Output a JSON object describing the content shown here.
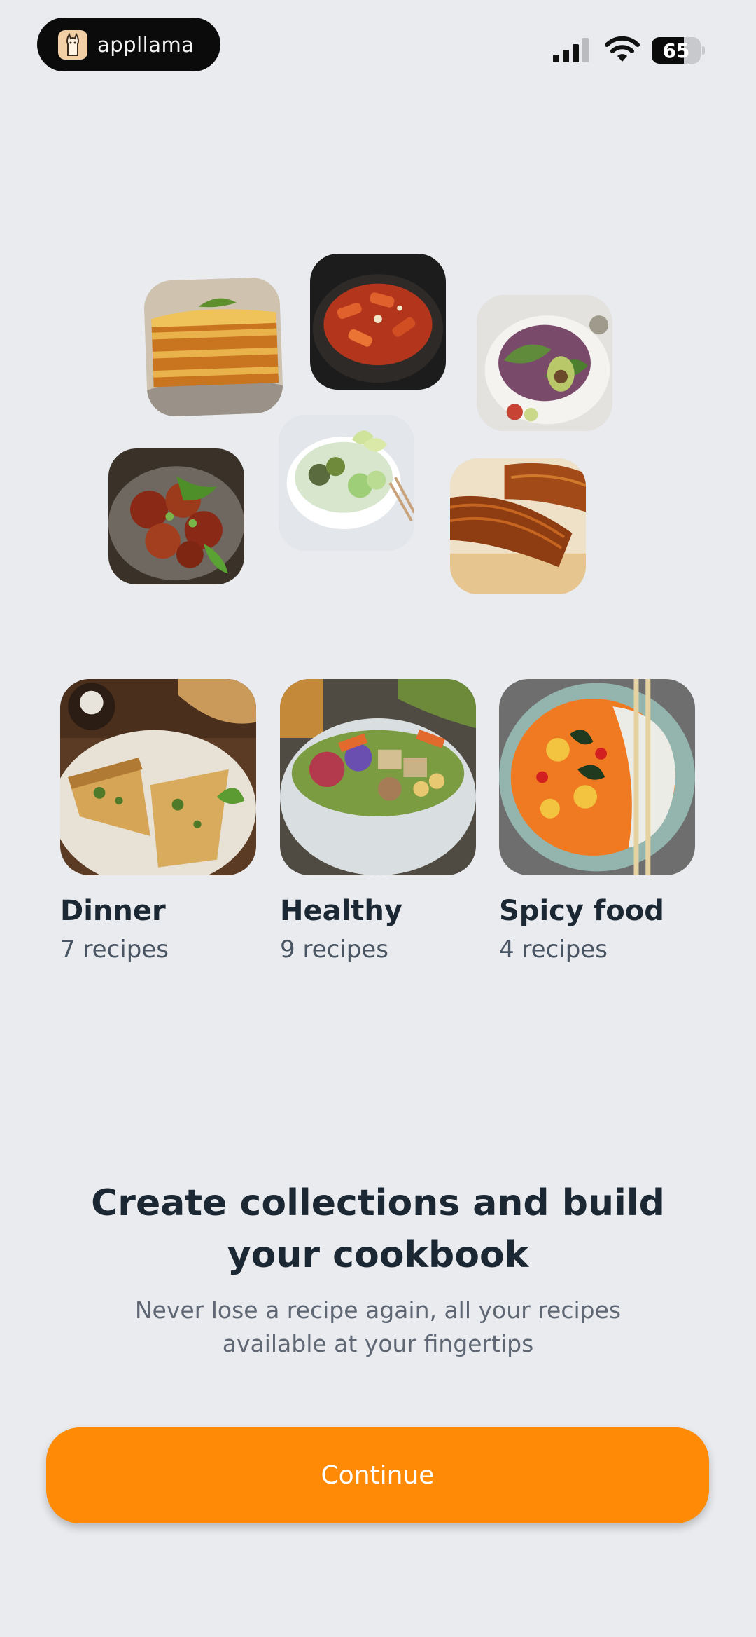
{
  "status_bar": {
    "brand_name": "appllama",
    "battery_level": "65",
    "battery_percent": 65,
    "icons": [
      "llama-logo-icon",
      "cellular-signal-icon",
      "wifi-icon",
      "battery-icon"
    ]
  },
  "collage": {
    "tiles": [
      "lasagna-photo",
      "rigatoni-pasta-photo",
      "avocado-salad-photo",
      "spicy-wings-photo",
      "edamame-bowl-photo",
      "glazed-eel-photo"
    ]
  },
  "categories": [
    {
      "title": "Dinner",
      "count": "7 recipes",
      "photo": "quiche-photo"
    },
    {
      "title": "Healthy",
      "count": "9 recipes",
      "photo": "tofu-buddha-bowl-photo"
    },
    {
      "title": "Spicy food",
      "count": "4 recipes",
      "photo": "red-curry-photo"
    }
  ],
  "onboarding": {
    "headline_line1": "Create collections and build",
    "headline_line2": "your cookbook",
    "subline_line1": "Never lose a recipe again, all your recipes",
    "subline_line2": "available at your fingertips"
  },
  "actions": {
    "continue_label": "Continue"
  },
  "colors": {
    "background": "#e9ebee",
    "accent": "#ff8a06",
    "text_primary": "#1b2733",
    "text_secondary": "#5e6773"
  }
}
